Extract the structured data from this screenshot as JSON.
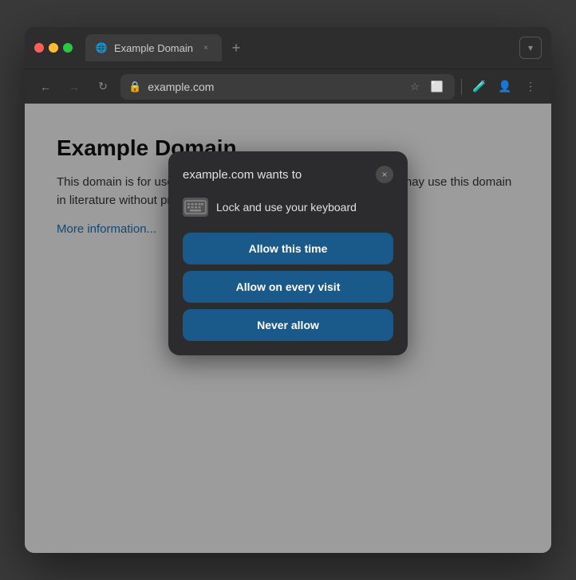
{
  "browser": {
    "title": "Example Domain",
    "tab_label": "Example Domain",
    "tab_close": "×",
    "new_tab_btn": "+",
    "dropdown_btn": "▾",
    "address": "example.com",
    "back_btn": "←",
    "forward_btn": "→",
    "reload_btn": "↻"
  },
  "page": {
    "title": "Example Domain",
    "body": "This domain is for use in illustrative examples in documents. You may use this domain in literature without prior coordination or asking for permission.",
    "link": "More information..."
  },
  "popup": {
    "title": "example.com wants to",
    "close_label": "×",
    "permission_text": "Lock and use your keyboard",
    "btn_allow_this_time": "Allow this time",
    "btn_allow_every_visit": "Allow on every visit",
    "btn_never_allow": "Never allow"
  }
}
